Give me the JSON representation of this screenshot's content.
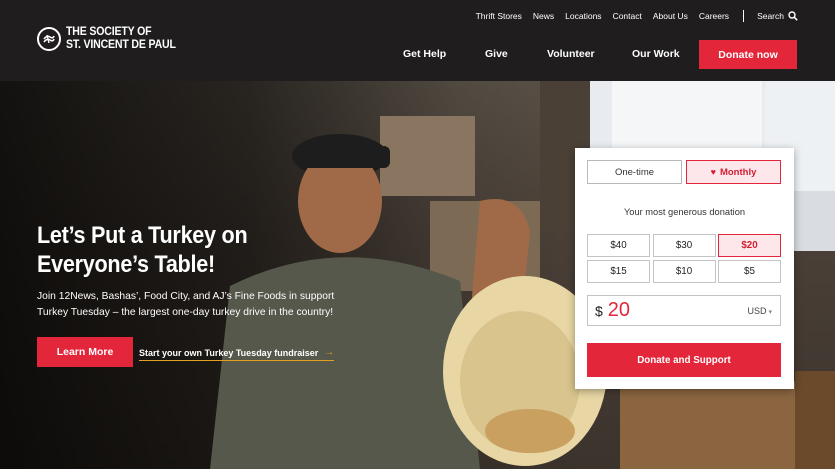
{
  "brand": {
    "name_line1": "THE SOCIETY OF",
    "name_line2": "ST. VINCENT DE PAUL",
    "accent": "#e3263a",
    "header_bg": "#1f1d1d"
  },
  "utility_nav": {
    "items": [
      "Thrift Stores",
      "News",
      "Locations",
      "Contact",
      "About Us",
      "Careers"
    ],
    "search_label": "Search",
    "search_icon": "search-icon"
  },
  "main_nav": {
    "items": [
      "Get Help",
      "Give",
      "Volunteer",
      "Our Work"
    ],
    "cta_label": "Donate now"
  },
  "hero": {
    "title": "Let’s Put a Turkey on Everyone’s Table!",
    "body": "Join 12News, Bashas’, Food City, and AJ’s Fine Foods in support Turkey Tuesday – the largest one-day turkey drive in the country!",
    "learn_more_label": "Learn More",
    "fundraiser_label": "Start your own Turkey Tuesday fundraiser",
    "fundraiser_arrow": "→"
  },
  "donation": {
    "frequency_options": [
      "One-time",
      "Monthly"
    ],
    "selected_frequency": "Monthly",
    "monthly_icon": "heart-icon",
    "prompt": "Your most generous donation",
    "amounts": [
      "$40",
      "$30",
      "$20",
      "$15",
      "$10",
      "$5"
    ],
    "selected_amount": "$20",
    "currency_symbol": "$",
    "amount_value": "20",
    "currency_code": "USD",
    "submit_label": "Donate and Support"
  }
}
